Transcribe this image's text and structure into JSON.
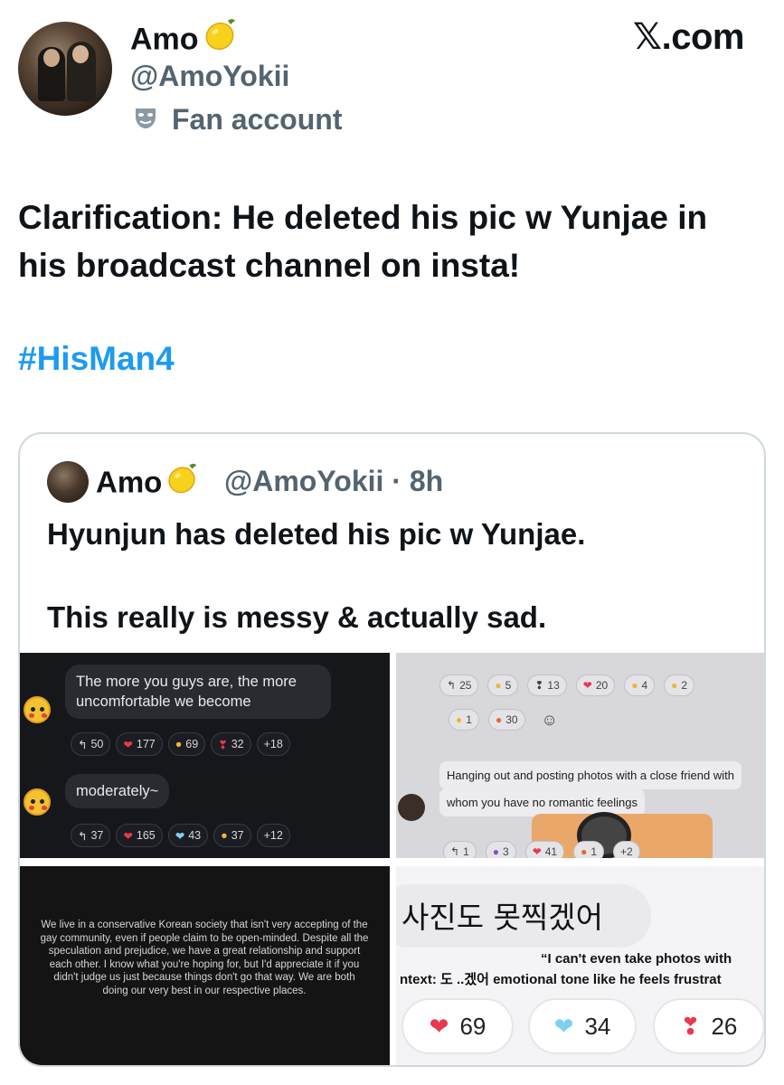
{
  "brand": "𝕏.com",
  "author": {
    "name": "Amo",
    "handle": "@AmoYokii",
    "label": "Fan account",
    "name_emoji_icon": "lemon-icon",
    "label_icon": "theater-mask-icon"
  },
  "post": {
    "text": "Clarification: He deleted his pic w Yunjae in his broadcast channel on insta!",
    "hashtag": "#HisMan4"
  },
  "quoted": {
    "name": "Amo",
    "handle_time": "@AmoYokii · 8h",
    "line1": "Hyunjun has deleted his pic w Yunjae.",
    "line2": "This really is messy & actually sad.",
    "media": {
      "tile1": {
        "msg1": "The more you guys are, the more uncomfortable we become",
        "msg1_reactions": [
          "50",
          "177",
          "69",
          "32",
          "+18"
        ],
        "msg2": "moderately~",
        "msg2_reactions": [
          "37",
          "165",
          "43",
          "37",
          "+12"
        ]
      },
      "tile2": {
        "row1": [
          "25",
          "5",
          "13",
          "20",
          "4",
          "2"
        ],
        "row2": [
          "1",
          "30"
        ],
        "msg_line1": "Hanging out and posting photos with a close friend with",
        "msg_line2": "whom you have no romantic feelings",
        "row3": [
          "1",
          "3",
          "41",
          "1",
          "+2"
        ]
      },
      "tile3": {
        "text": "We live in a conservative Korean society that isn't very accepting of the gay community, even if people claim to be open-minded. Despite all the speculation and prejudice, we have a great relationship and support each other. I know what you're hoping for, but I'd appreciate it if you didn't judge us just because things don't go that way. We are both doing our very best in our respective places."
      },
      "tile4": {
        "korean": "사진도 못찍겠어",
        "caption1": "“I can't even take photos with",
        "caption2": "ntext: 도 ..겠어 emotional tone like he feels frustrat",
        "reactions": [
          "69",
          "34",
          "26"
        ]
      }
    }
  },
  "colors": {
    "accent": "#1d9bf0",
    "secondary_text": "#536471",
    "border": "#cfd9de"
  }
}
